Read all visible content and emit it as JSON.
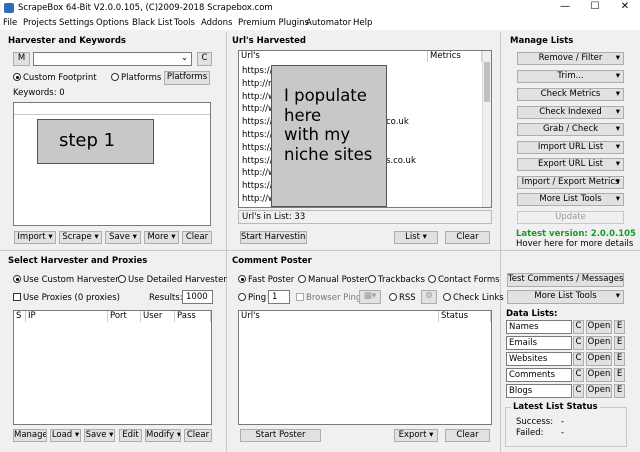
{
  "title": "ScrapeBox 64-Bit V2.0.0.105, (C)2009-2018 Scrapebox.com",
  "winbtns": [
    "—",
    "☐",
    "✕"
  ],
  "menu": [
    "File",
    "Projects",
    "Settings",
    "Options",
    "Black List",
    "Tools",
    "Addons",
    "Premium Plugins",
    "Automator",
    "Help"
  ],
  "harvester": {
    "title": "Harvester and Keywords",
    "m": "M",
    "c": "C",
    "custom_footprint": "Custom Footprint",
    "platforms_radio": "Platforms",
    "platforms_btn": "Platforms",
    "keywords": "Keywords:  0",
    "buttons": [
      "Import",
      "Scrape",
      "Save",
      "More",
      "Clear"
    ]
  },
  "urls": {
    "title": "Url's Harvested",
    "col_urls": "Url's",
    "col_metrics": "Metrics",
    "rows": [
      "https://w",
      "http://nig",
      "http://ww",
      "http://ww",
      "https://ln",
      "https://w",
      "https://w",
      "https://w",
      "http://ww",
      "https://w",
      "http://ww"
    ],
    "frag1": "co.uk",
    "frag2": "s.co.uk",
    "count": "Url's in List: 33",
    "start": "Start Harvesting",
    "list": "List",
    "clear": "Clear"
  },
  "overlay_step": "step 1",
  "overlay_text": [
    "I populate",
    "here",
    "with my",
    "niche sites"
  ],
  "manage": {
    "title": "Manage Lists",
    "buttons": [
      "Remove / Filter",
      "Trim...",
      "Check Metrics",
      "Check Indexed",
      "Grab / Check",
      "Import URL List",
      "Export URL List",
      "Import / Export Metrics",
      "More List Tools"
    ],
    "update": "Update",
    "latest": "Latest version:  2.0.0.105",
    "hover": "Hover here for more details"
  },
  "proxies": {
    "title": "Select Harvester and Proxies",
    "use_custom": "Use Custom Harvester",
    "use_detailed": "Use Detailed Harvester",
    "use_proxies": "Use Proxies  (0 proxies)",
    "results_label": "Results:",
    "results_value": "1000",
    "cols": [
      "S",
      "IP",
      "Port",
      "User",
      "Pass"
    ],
    "buttons": [
      "Manage",
      "Load",
      "Save",
      "Edit",
      "Modify",
      "Clear"
    ]
  },
  "poster": {
    "title": "Comment Poster",
    "fast": "Fast Poster",
    "manual": "Manual Poster",
    "trackbacks": "Trackbacks",
    "contact": "Contact Forms",
    "ping": "Ping",
    "ping_value": "1",
    "browser_ping": "Browser Ping",
    "rss": "RSS",
    "check_links": "Check Links",
    "col_urls": "Url's",
    "col_status": "Status",
    "start": "Start Poster",
    "export": "Export",
    "clear": "Clear"
  },
  "right_bottom": {
    "test": "Test Comments / Messages",
    "more_list_tools": "More List Tools",
    "data_lists": "Data Lists:",
    "lists": [
      "Names",
      "Emails",
      "Websites",
      "Comments",
      "Blogs"
    ],
    "c": "C",
    "open": "Open",
    "e": "E",
    "latest_status": "Latest List Status",
    "success": "Success:",
    "success_val": "-",
    "failed": "Failed:",
    "failed_val": "-"
  }
}
